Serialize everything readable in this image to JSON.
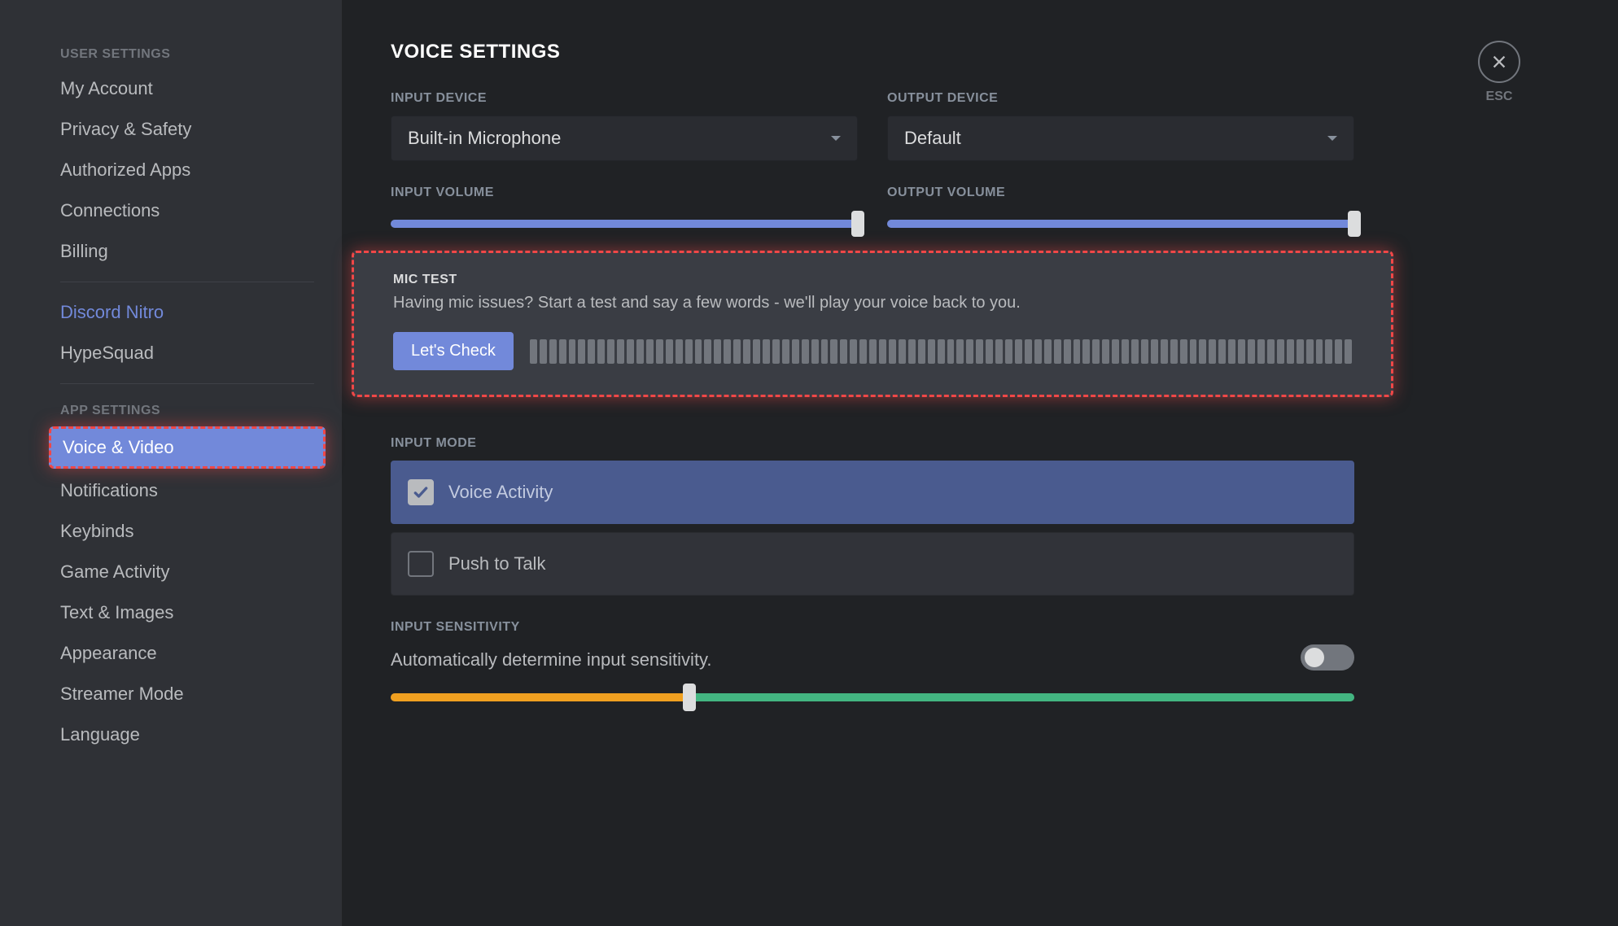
{
  "sidebar": {
    "user_settings_header": "User Settings",
    "app_settings_header": "App Settings",
    "items_user": [
      "My Account",
      "Privacy & Safety",
      "Authorized Apps",
      "Connections",
      "Billing"
    ],
    "nitro": "Discord Nitro",
    "hypesquad": "HypeSquad",
    "items_app": [
      "Voice & Video",
      "Notifications",
      "Keybinds",
      "Game Activity",
      "Text & Images",
      "Appearance",
      "Streamer Mode",
      "Language"
    ]
  },
  "page": {
    "title": "Voice Settings",
    "input_device_label": "Input Device",
    "input_device_value": "Built-in Microphone",
    "output_device_label": "Output Device",
    "output_device_value": "Default",
    "input_volume_label": "Input Volume",
    "input_volume_percent": 100,
    "output_volume_label": "Output Volume",
    "output_volume_percent": 100,
    "mic_test": {
      "title": "Mic Test",
      "desc": "Having mic issues? Start a test and say a few words - we'll play your voice back to you.",
      "button": "Let's Check"
    },
    "input_mode": {
      "label": "Input Mode",
      "options": [
        {
          "label": "Voice Activity",
          "checked": true
        },
        {
          "label": "Push to Talk",
          "checked": false
        }
      ]
    },
    "sensitivity": {
      "label": "Input Sensitivity",
      "auto_text": "Automatically determine input sensitivity.",
      "auto_on": false,
      "threshold_percent": 31
    },
    "esc_label": "ESC"
  }
}
